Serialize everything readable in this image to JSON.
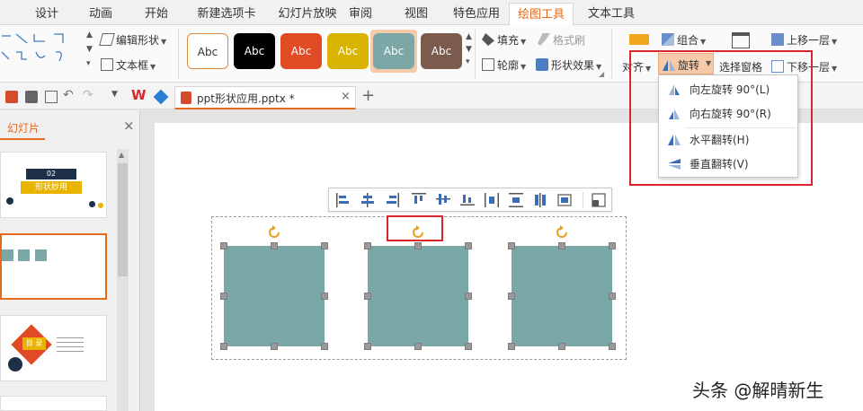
{
  "tabs": [
    "设计",
    "动画",
    "开始",
    "新建选项卡",
    "幻灯片放映",
    "审阅",
    "视图",
    "特色应用",
    "绘图工具",
    "文本工具"
  ],
  "active_tab_index": 8,
  "ribbon": {
    "edit_shape": "编辑形状",
    "text_box": "文本框",
    "style_label": "Abc",
    "styles": [
      {
        "bg": "#ffffff",
        "border": "#e08a3c",
        "fg": "#333333"
      },
      {
        "bg": "#000000",
        "border": "#000000",
        "fg": "#ffffff"
      },
      {
        "bg": "#e04a24",
        "border": "#e04a24",
        "fg": "#ffffff"
      },
      {
        "bg": "#d8b400",
        "border": "#d8b400",
        "fg": "#ffffff"
      },
      {
        "bg": "#7ba7a6",
        "border": "#7ba7a6",
        "fg": "#ffffff"
      },
      {
        "bg": "#7b5b4e",
        "border": "#7b5b4e",
        "fg": "#ffffff"
      }
    ],
    "fill": "填充",
    "format_painter": "格式刷",
    "outline": "轮廓",
    "shape_effects": "形状效果",
    "group": "组合",
    "align": "对齐",
    "rotate": "旋转",
    "selection_pane": "选择窗格",
    "bring_forward": "上移一层",
    "send_backward": "下移一层"
  },
  "document": {
    "name": "ppt形状应用.pptx *"
  },
  "left_panel": {
    "title": "幻灯片"
  },
  "thumbnails": {
    "t1_number": "02",
    "t1_title": "形状妙用",
    "t3_title": "目 录"
  },
  "rotate_menu": {
    "rotate_left": "向左旋转 90°(L)",
    "rotate_right": "向右旋转 90°(R)",
    "flip_horizontal": "水平翻转(H)",
    "flip_vertical": "垂直翻转(V)"
  },
  "watermark": "头条 @解晴新生",
  "colors": {
    "accent": "#e56a1b",
    "highlight": "#d9262c",
    "shape": "#7ba7a6",
    "rotate_handle": "#e6a117"
  }
}
